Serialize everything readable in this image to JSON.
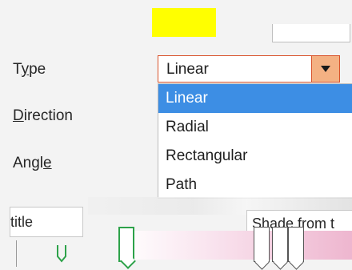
{
  "labels": {
    "type": "Type",
    "direction": "Direction",
    "angle": "Angle",
    "angle_prefix": "Angl",
    "angle_underlined": "e"
  },
  "type_combo": {
    "value": "Linear"
  },
  "dropdown": {
    "items": [
      "Linear",
      "Radial",
      "Rectangular",
      "Path"
    ],
    "selected": "Linear"
  },
  "title_field": {
    "text": "title"
  },
  "shade_field": {
    "text": "Shade from t"
  },
  "gradient": {
    "colors": [
      "#ffffff",
      "#f9e3ee",
      "#eeb6cf"
    ],
    "stop_accent": "#2da24a"
  },
  "accent_colors": {
    "combo_border": "#d9532b",
    "combo_arrow": "#f4b183",
    "selected_item": "#3d8ee4",
    "swatch": "#ffff00"
  }
}
